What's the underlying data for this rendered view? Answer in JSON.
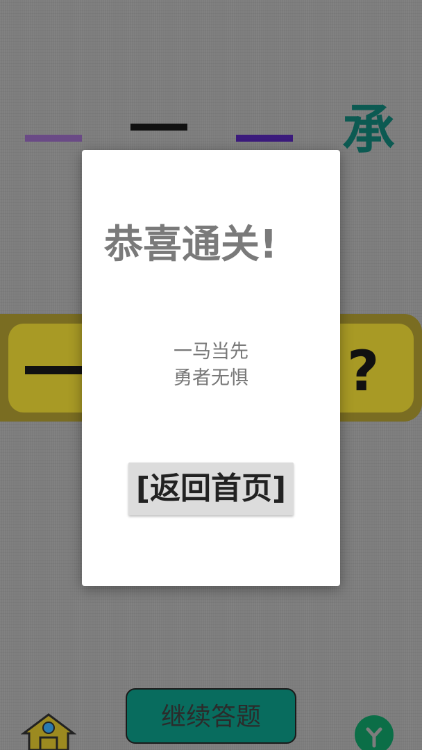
{
  "game": {
    "top_row": [
      {
        "glyph": "dash",
        "color": "#6a4a86"
      },
      {
        "glyph": "dash",
        "color": "#111111"
      },
      {
        "glyph": "dash",
        "color": "#3b1a7c"
      },
      {
        "glyph": "承",
        "color": "#0c5a52"
      }
    ],
    "answer_panel": {
      "left_glyph": "dash",
      "right_text": "?"
    }
  },
  "dialog": {
    "title": "恭喜通关!",
    "message_line1": "一马当先",
    "message_line2": "勇者无惧",
    "home_button_label": "[返回首页]"
  },
  "bottom_bar": {
    "continue_button_label": "继续答题",
    "home_icon": "house-icon",
    "share_icon": "share-icon"
  },
  "colors": {
    "background": "#7d7d7d",
    "panel": "#a89a25",
    "dialog": "#ffffff",
    "continue_button": "#086c5e"
  }
}
